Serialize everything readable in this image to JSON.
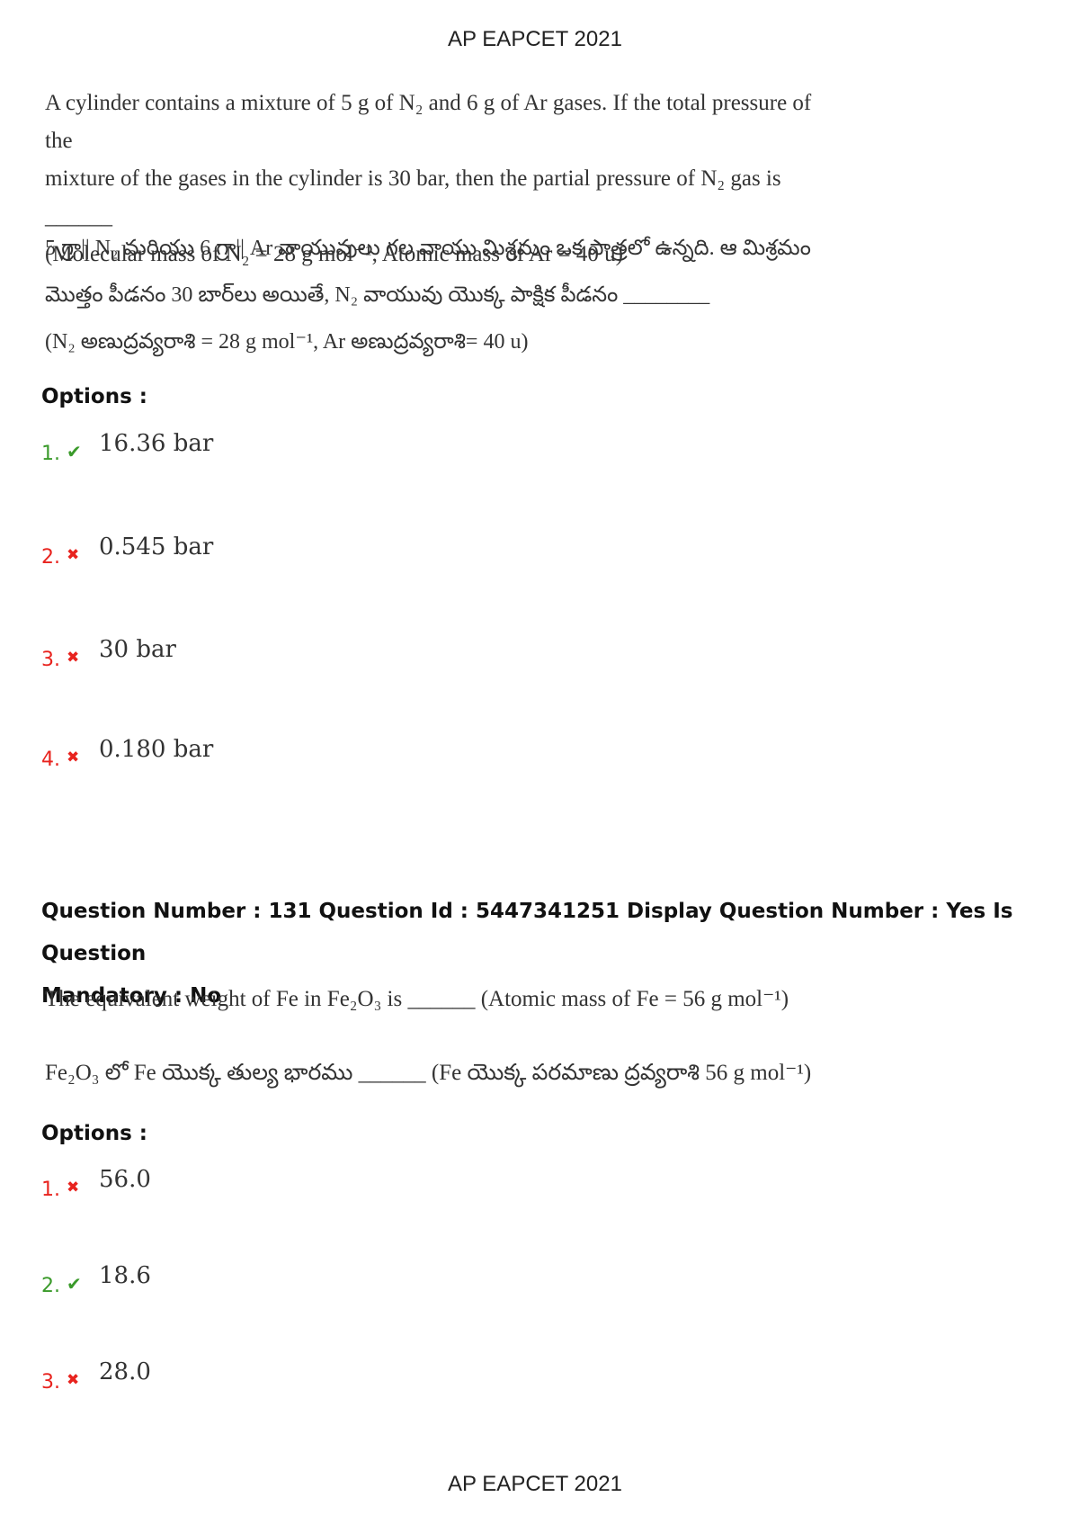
{
  "header": {
    "title": "AP EAPCET 2021"
  },
  "footer": {
    "title": "AP EAPCET 2021"
  },
  "question1": {
    "english_line1": "A cylinder contains a mixture of 5 g of N₂ and 6 g of Ar gases. If the total pressure of the",
    "english_line2": "mixture of the gases in the cylinder is 30 bar, then the partial pressure of N₂ gas is ______",
    "english_line3": "(Molecular mass of N₂ = 28 g mol⁻¹, Atomic mass of Ar = 40 u)",
    "telugu_line1": "5 గ్రా|| N₂ మరియు 6 గ్రా|| Ar వాయువులు గల వాయు మిశ్రమం ఒక పాత్రలో ఉన్నది. ఆ మిశ్రమం",
    "telugu_line2": "మొత్తం పీడనం 30 బార్‌లు అయితే, N₂ వాయువు యొక్క పాక్షిక పీడనం ________",
    "telugu_line3": "(N₂ అణుద్రవ్యరాశి = 28 g mol⁻¹, Ar అణుద్రవ్యరాశి= 40 u)",
    "options_label": "Options :",
    "options": [
      {
        "num": "1.",
        "value": "16.36 bar",
        "status": "correct"
      },
      {
        "num": "2.",
        "value": "0.545 bar",
        "status": "wrong"
      },
      {
        "num": "3.",
        "value": "30 bar",
        "status": "wrong"
      },
      {
        "num": "4.",
        "value": "0.180 bar",
        "status": "wrong"
      }
    ]
  },
  "question2": {
    "meta_line1": "Question Number : 131 Question Id : 5447341251 Display Question Number : Yes Is Question",
    "meta_line2": "Mandatory : No",
    "english_line1": "The equivalent weight of Fe in Fe₂O₃ is ______ (Atomic mass of Fe = 56 g mol⁻¹)",
    "telugu_line1": "Fe₂O₃ లో Fe యొక్క తుల్య భారము ______ (Fe యొక్క పరమాణు ద్రవ్యరాశి 56 g mol⁻¹)",
    "options_label": "Options :",
    "options": [
      {
        "num": "1.",
        "value": "56.0",
        "status": "wrong"
      },
      {
        "num": "2.",
        "value": "18.6",
        "status": "correct"
      },
      {
        "num": "3.",
        "value": "28.0",
        "status": "wrong"
      }
    ]
  },
  "icons": {
    "correct": "check-icon",
    "wrong": "cross-icon"
  },
  "colors": {
    "correct": "#3a9a2a",
    "wrong": "#e8231e"
  }
}
